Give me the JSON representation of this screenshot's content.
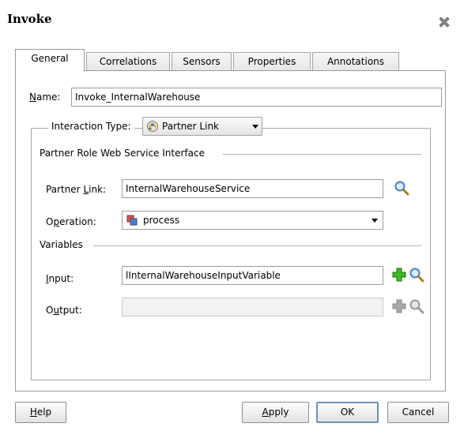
{
  "dialog": {
    "title": "Invoke",
    "close_icon": "close-icon"
  },
  "tabs": [
    {
      "label": "General",
      "active": true
    },
    {
      "label": "Correlations",
      "active": false
    },
    {
      "label": "Sensors",
      "active": false
    },
    {
      "label": "Properties",
      "active": false
    },
    {
      "label": "Annotations",
      "active": false
    }
  ],
  "general": {
    "name_label_mnemonic": "N",
    "name_label_rest": "ame:",
    "name_value": "Invoke_InternalWarehouse",
    "interaction_type_label": "Interaction Type:",
    "interaction_type_value": "Partner Link",
    "partner_role_section": "Partner Role Web Service Interface",
    "partner_link_label_pre": "Partner ",
    "partner_link_label_mnemonic": "L",
    "partner_link_label_post": "ink:",
    "partner_link_value": "InternalWarehouseService",
    "operation_label_pre": "O",
    "operation_label_mnemonic": "p",
    "operation_label_post": "eration:",
    "operation_value": "process",
    "variables_section": "Variables",
    "input_label_mnemonic": "I",
    "input_label_rest": "nput:",
    "input_value": "lInternalWarehouseInputVariable",
    "output_label_pre": "O",
    "output_label_mnemonic": "u",
    "output_label_post": "tput:",
    "output_value": ""
  },
  "buttons": {
    "help_mnemonic": "H",
    "help_rest": "elp",
    "apply_mnemonic": "A",
    "apply_rest": "pply",
    "ok": "OK",
    "cancel": "Cancel"
  },
  "colors": {
    "add_icon_enabled": "#2e9a1e",
    "search_icon": "#4a7fc1",
    "disabled_icon": "#9a9a9a",
    "default_button_border": "#6f8fb8"
  }
}
